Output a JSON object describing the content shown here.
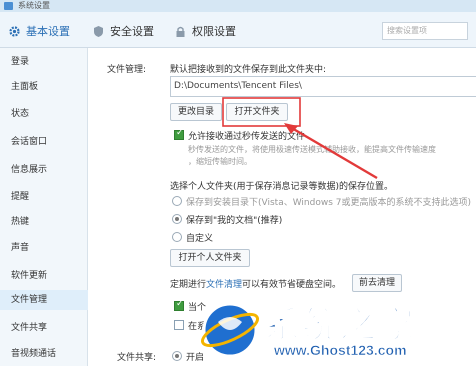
{
  "window": {
    "title": "系统设置"
  },
  "tabs": {
    "basic": "基本设置",
    "security": "安全设置",
    "permission": "权限设置",
    "search_placeholder": "搜索设置项"
  },
  "sidebar": {
    "items": [
      "登录",
      "主面板",
      "状态",
      "会话窗口",
      "信息展示",
      "提醒",
      "热键",
      "声音",
      "软件更新",
      "文件管理",
      "文件共享",
      "音视频通话"
    ],
    "active": "文件管理"
  },
  "file_mgmt": {
    "label": "文件管理:",
    "desc": "默认把接收到的文件保存到此文件夹中:",
    "path_value": "D:\\Documents\\Tencent Files\\",
    "change_dir_button": "更改目录",
    "open_folder_button": "打开文件夹",
    "allow_transfer_label": "允许接收通过秒传发送的文件",
    "allow_transfer_checked": true,
    "transfer_desc_1": "秒传发送的文件，将使用极速传送模式辅助接收，能提高文件传输速度",
    "transfer_desc_2": "，缩短传输时间。",
    "personal_folder_title": "选择个人文件夹(用于保存消息记录等数据)的保存位置。",
    "option_install_dir": "保存到安装目录下(Vista、Windows 7或更高版本的系统不支持此选项)",
    "option_my_docs": "保存到\"我的文档\"(推荐)",
    "option_custom": "自定义",
    "selected_option": "my_docs",
    "open_personal_folder_button": "打开个人文件夹",
    "cleanup_text_before": "定期进行",
    "cleanup_link": "文件清理",
    "cleanup_text_after": "可以有效节省硬盘空间。",
    "cleanup_button": "前去清理",
    "cb1_label": "当个",
    "cb1_checked": true,
    "cb2_label": "在系",
    "cb2_checked": false
  },
  "file_share": {
    "label": "文件共享:",
    "option_label": "开启"
  },
  "watermark": {
    "text_cn": "系统之家",
    "text_url": "www.Ghost123.com"
  },
  "colors": {
    "accent": "#2a6fb5",
    "annotation_red": "#e23a3a",
    "check_green": "#3f9c3f"
  }
}
